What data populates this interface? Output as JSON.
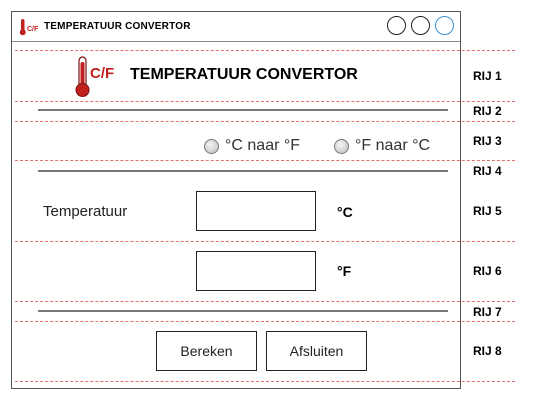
{
  "window": {
    "title": "TEMPERATUUR CONVERTOR",
    "logo_text": "C/F",
    "controls": [
      "minimize-button",
      "maximize-button",
      "close-button"
    ]
  },
  "header": {
    "logo_text": "C/F",
    "title": "TEMPERATUUR CONVERTOR"
  },
  "conversion": {
    "option_c_to_f": "°C naar °F",
    "option_f_to_c": "°F naar °C"
  },
  "form": {
    "temperature_label": "Temperatuur",
    "celsius_value": "",
    "fahrenheit_value": "",
    "celsius_unit": "°C",
    "fahrenheit_unit": "°F"
  },
  "buttons": {
    "calculate_label": "Bereken",
    "close_label": "Afsluiten"
  },
  "rows": [
    "RIJ 1",
    "RIJ 2",
    "RIJ 3",
    "RIJ 4",
    "RIJ 5",
    "RIJ 6",
    "RIJ 7",
    "RIJ 8"
  ],
  "colors": {
    "guide": "#e07070",
    "accent": "#3c8fd0",
    "thermometer": "#c0201e"
  }
}
